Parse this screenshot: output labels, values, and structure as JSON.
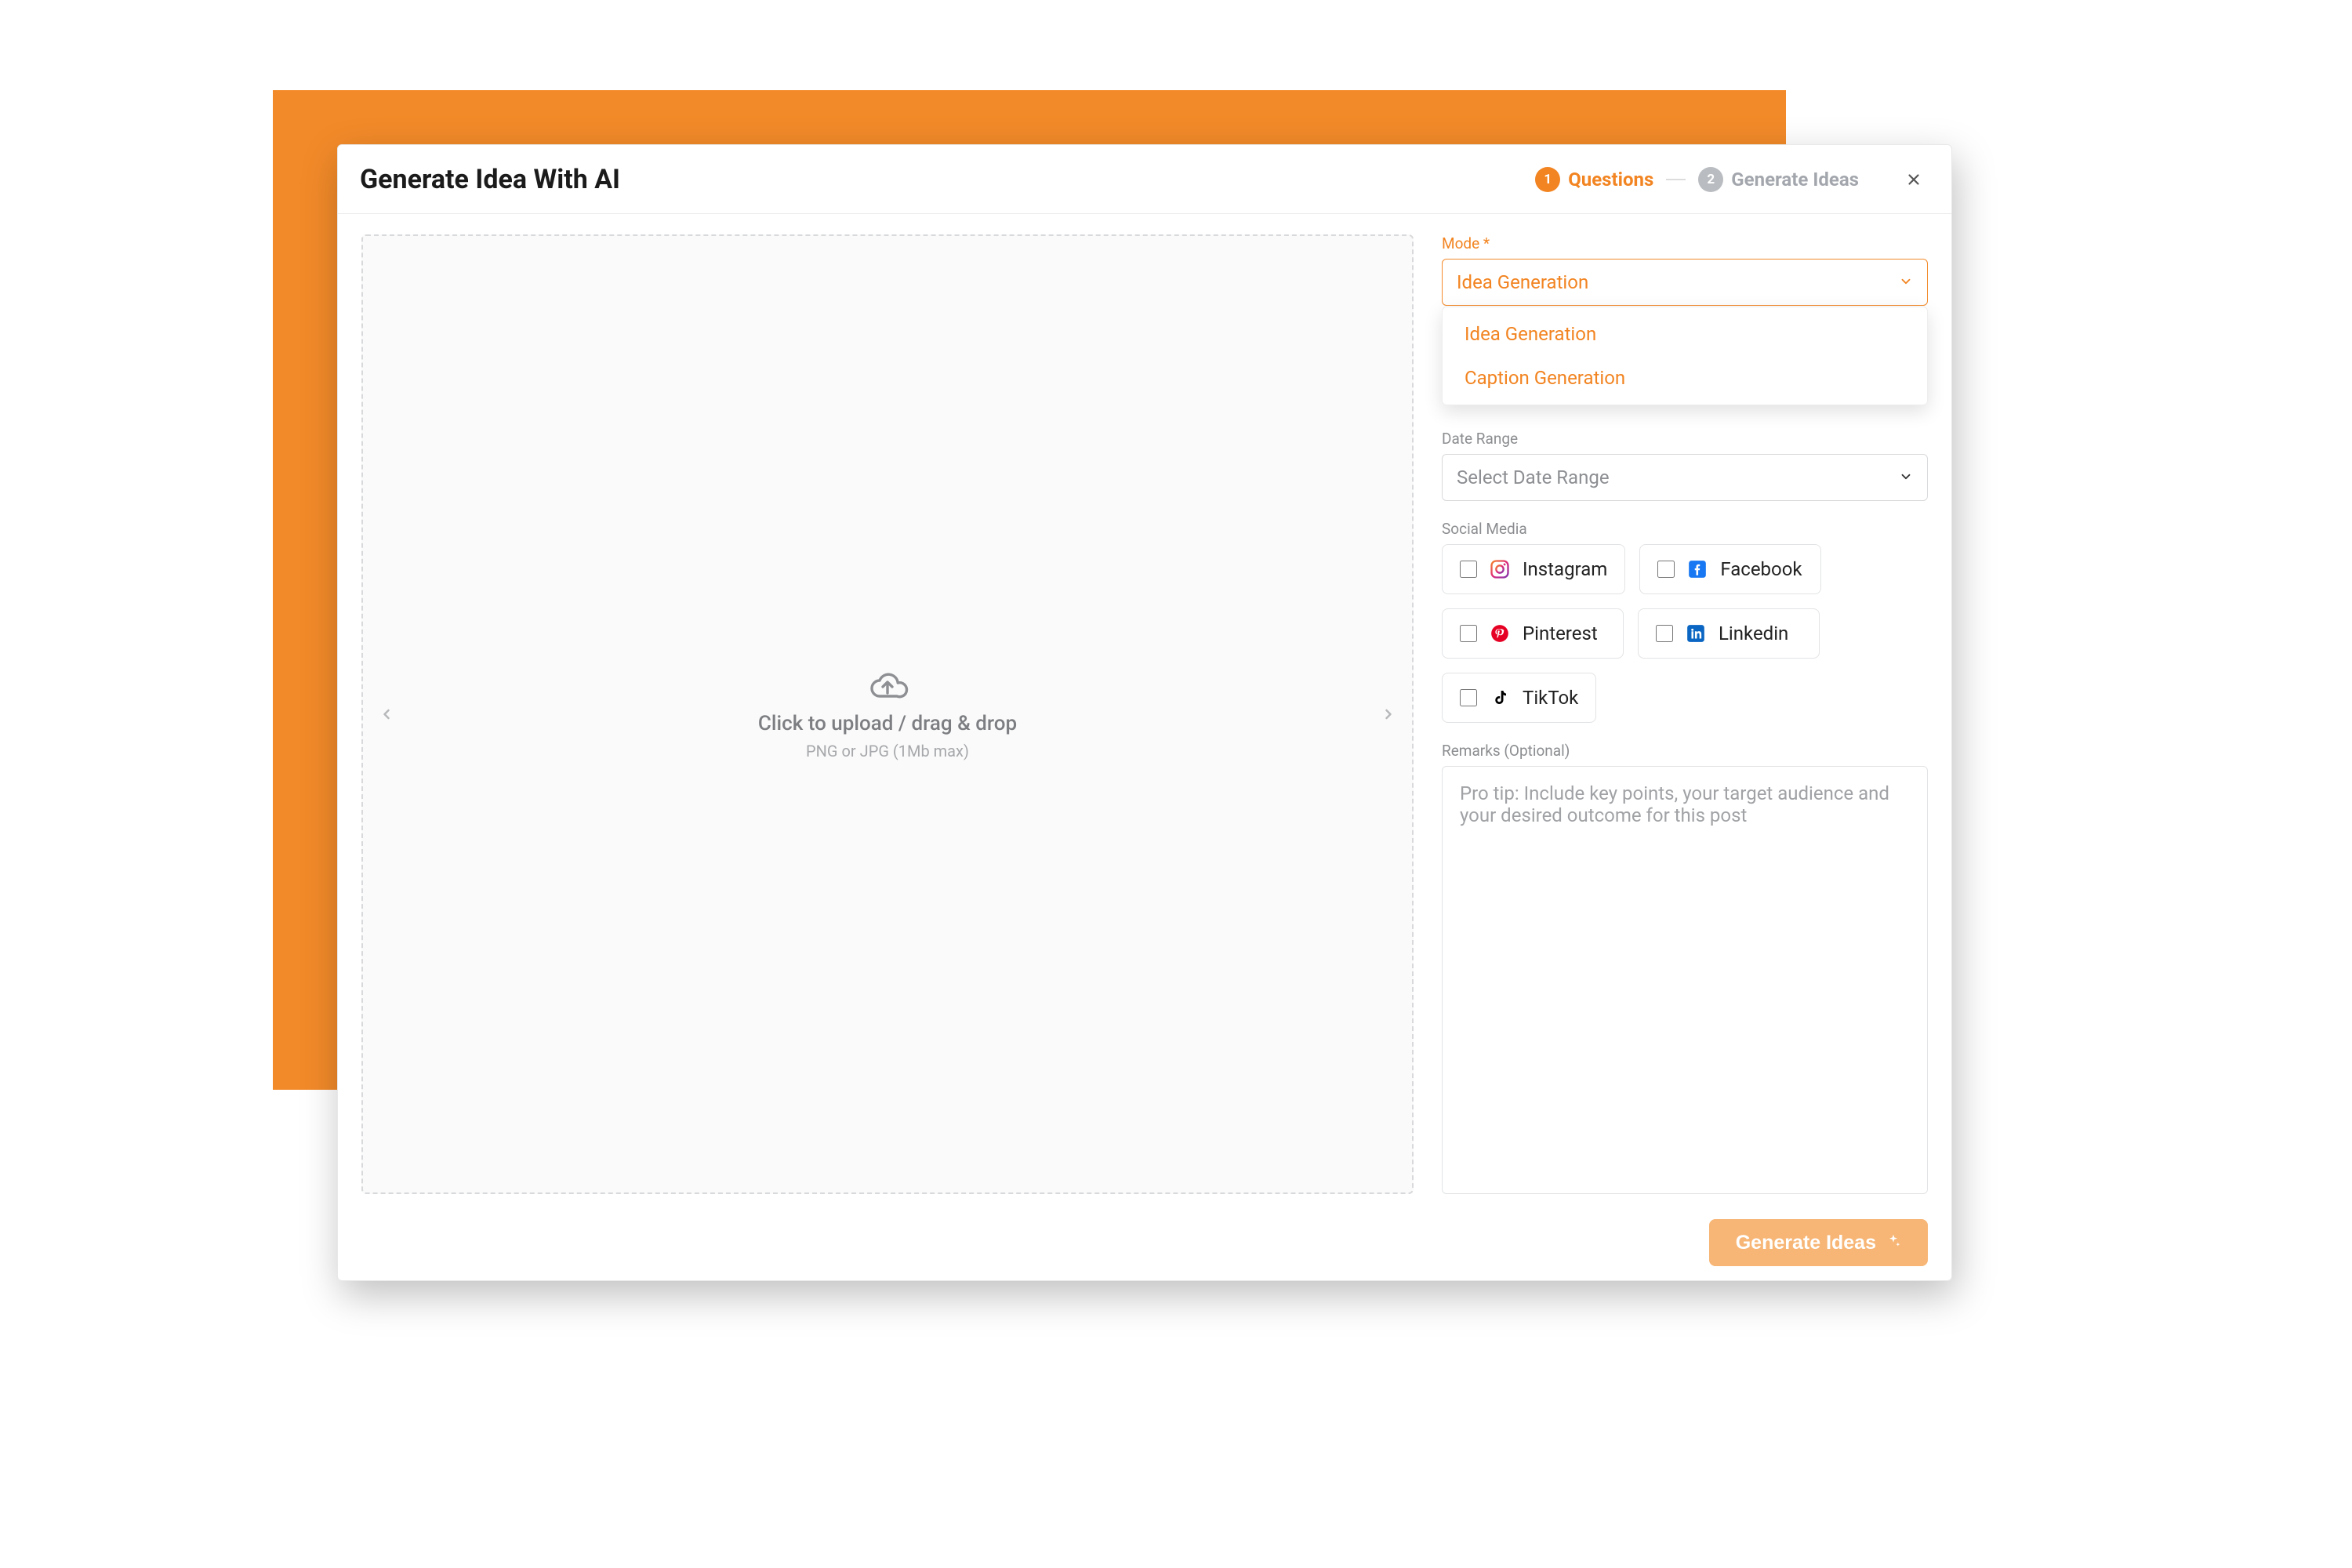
{
  "header": {
    "title": "Generate Idea With AI",
    "steps": [
      {
        "num": "1",
        "label": "Questions",
        "state": "active"
      },
      {
        "num": "2",
        "label": "Generate Ideas",
        "state": "inactive"
      }
    ]
  },
  "upload": {
    "title": "Click to upload / drag & drop",
    "subtitle": "PNG or JPG (1Mb max)"
  },
  "mode": {
    "label": "Mode *",
    "value": "Idea Generation",
    "options": [
      "Idea Generation",
      "Caption Generation"
    ]
  },
  "date_range": {
    "label": "Date Range",
    "placeholder": "Select Date Range"
  },
  "social": {
    "label": "Social Media",
    "items": [
      {
        "key": "instagram",
        "label": "Instagram"
      },
      {
        "key": "facebook",
        "label": "Facebook"
      },
      {
        "key": "pinterest",
        "label": "Pinterest"
      },
      {
        "key": "linkedin",
        "label": "Linkedin"
      },
      {
        "key": "tiktok",
        "label": "TikTok"
      }
    ]
  },
  "remarks": {
    "label": "Remarks (Optional)",
    "placeholder": "Pro tip: Include key points, your target audience and your desired outcome for this post"
  },
  "footer": {
    "button": "Generate Ideas"
  },
  "colors": {
    "accent": "#f28421",
    "accent_light": "#f7b676"
  }
}
